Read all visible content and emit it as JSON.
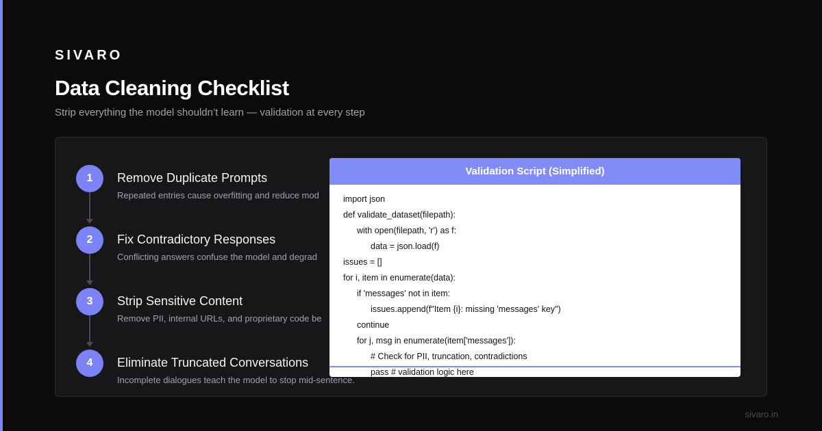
{
  "brand": "SIVARO",
  "title": "Data Cleaning Checklist",
  "subtitle": "Strip everything the model shouldn’t learn — validation at every step",
  "steps": [
    {
      "number": "1",
      "title": "Remove Duplicate Prompts",
      "description": "Repeated entries cause overfitting and reduce mod"
    },
    {
      "number": "2",
      "title": "Fix Contradictory Responses",
      "description": "Conflicting answers confuse the model and degrad"
    },
    {
      "number": "3",
      "title": "Strip Sensitive Content",
      "description": "Remove PII, internal URLs, and proprietary code be"
    },
    {
      "number": "4",
      "title": "Eliminate Truncated Conversations",
      "description": "Incomplete dialogues teach the model to stop mid-sentence."
    }
  ],
  "code_card": {
    "title": "Validation Script (Simplified)",
    "lines": [
      {
        "indent": 0,
        "text": "import json"
      },
      {
        "indent": 0,
        "text": "def validate_dataset(filepath):"
      },
      {
        "indent": 1,
        "text": "with open(filepath, 'r') as f:"
      },
      {
        "indent": 2,
        "text": "data = json.load(f)"
      },
      {
        "indent": 0,
        "text": "issues = []"
      },
      {
        "indent": 0,
        "text": "for i, item in enumerate(data):"
      },
      {
        "indent": 1,
        "text": "if 'messages' not in item:"
      },
      {
        "indent": 2,
        "text": "issues.append(f\"Item {i}: missing 'messages' key\")"
      },
      {
        "indent": 1,
        "text": "continue"
      },
      {
        "indent": 1,
        "text": "for j, msg in enumerate(item['messages']):"
      },
      {
        "indent": 2,
        "text": "# Check for PII, truncation, contradictions"
      },
      {
        "indent": 2,
        "text": "pass # validation logic here"
      }
    ]
  },
  "footer": "sivaro.in",
  "colors": {
    "accent": "#7b83f6",
    "header": "#818cf8",
    "background": "#0b0b0c",
    "panel": "#17171a"
  }
}
